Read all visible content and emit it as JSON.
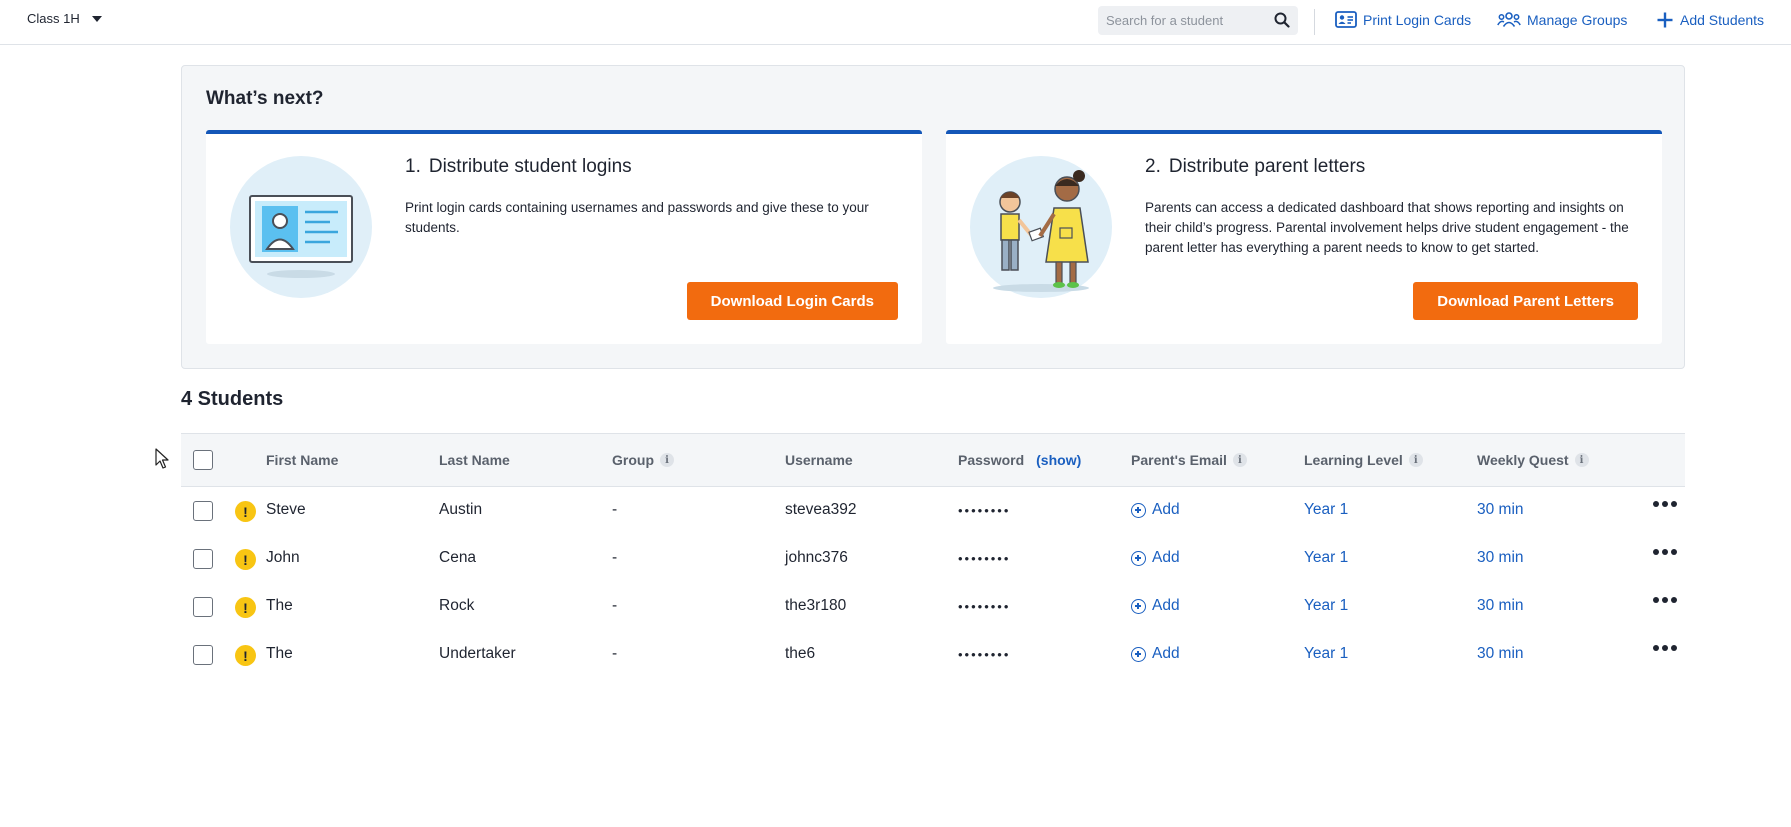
{
  "topbar": {
    "class_name": "Class 1H",
    "search_placeholder": "Search for a student",
    "print_login_cards": "Print Login Cards",
    "manage_groups": "Manage Groups",
    "add_students": "Add Students"
  },
  "whats_next": {
    "title": "What’s next?",
    "cards": [
      {
        "number": "1.",
        "title": "Distribute student logins",
        "description": "Print login cards containing usernames and passwords and give these to your students.",
        "button": "Download Login Cards"
      },
      {
        "number": "2.",
        "title": "Distribute parent letters",
        "description": "Parents can access a dedicated dashboard that shows reporting and insights on their child’s progress. Parental involvement helps drive student engagement - the parent letter has everything a parent needs to know to get started.",
        "button": "Download Parent Letters"
      }
    ]
  },
  "students": {
    "title": "4 Students",
    "columns": {
      "first_name": "First Name",
      "last_name": "Last Name",
      "group": "Group",
      "username": "Username",
      "password": "Password",
      "password_show": "(show)",
      "parents_email": "Parent's Email",
      "learning_level": "Learning Level",
      "weekly_quest": "Weekly Quest"
    },
    "rows": [
      {
        "first": "Steve",
        "last": "Austin",
        "group": "-",
        "username": "stevea392",
        "password": "••••••••",
        "email_action": "Add",
        "level": "Year 1",
        "quest": "30 min"
      },
      {
        "first": "John",
        "last": "Cena",
        "group": "-",
        "username": "johnc376",
        "password": "••••••••",
        "email_action": "Add",
        "level": "Year 1",
        "quest": "30 min"
      },
      {
        "first": "The",
        "last": "Rock",
        "group": "-",
        "username": "the3r180",
        "password": "••••••••",
        "email_action": "Add",
        "level": "Year 1",
        "quest": "30 min"
      },
      {
        "first": "The",
        "last": "Undertaker",
        "group": "-",
        "username": "the6",
        "password": "••••••••",
        "email_action": "Add",
        "level": "Year 1",
        "quest": "30 min"
      }
    ],
    "warning_icon": "!",
    "info_icon": "i"
  },
  "colors": {
    "accent_blue": "#1a5fc0",
    "card_border_blue": "#1457b8",
    "button_orange": "#f26b0f",
    "warning_yellow": "#f8c513"
  }
}
